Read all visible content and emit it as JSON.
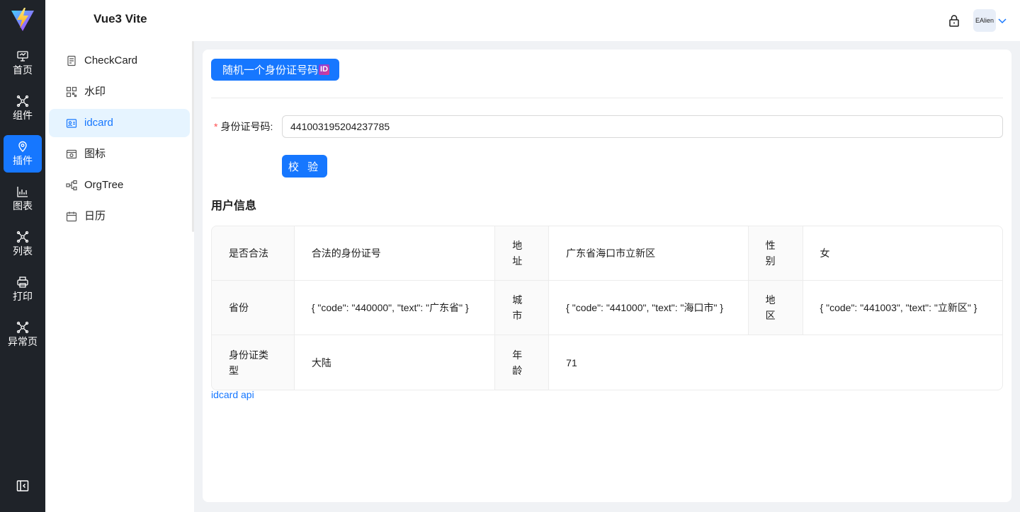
{
  "header": {
    "title": "Vue3 Vite",
    "user": "EAlien"
  },
  "nav": {
    "items": [
      {
        "label": "首页",
        "icon": "dashboard-icon",
        "active": false
      },
      {
        "label": "组件",
        "icon": "components-icon",
        "active": false
      },
      {
        "label": "插件",
        "icon": "plugin-icon",
        "active": true
      },
      {
        "label": "图表",
        "icon": "chart-icon",
        "active": false
      },
      {
        "label": "列表",
        "icon": "list-icon",
        "active": false
      },
      {
        "label": "打印",
        "icon": "printer-icon",
        "active": false
      },
      {
        "label": "异常页",
        "icon": "exception-icon",
        "active": false
      }
    ]
  },
  "submenu": {
    "items": [
      {
        "label": "CheckCard",
        "icon": "checkcard-icon",
        "active": false
      },
      {
        "label": "水印",
        "icon": "watermark-icon",
        "active": false
      },
      {
        "label": "idcard",
        "icon": "idcard-icon",
        "active": true
      },
      {
        "label": "图标",
        "icon": "icons-icon",
        "active": false
      },
      {
        "label": "OrgTree",
        "icon": "orgtree-icon",
        "active": false
      },
      {
        "label": "日历",
        "icon": "calendar-icon",
        "active": false
      }
    ]
  },
  "main": {
    "random_button": "随机一个身份证号码",
    "random_badge": "ID",
    "form": {
      "label": "身份证号码:",
      "value": "441003195204237785"
    },
    "verify_button": "校 验",
    "section_title": "用户信息",
    "table": {
      "rows": [
        [
          {
            "k": "是否合法",
            "v": "合法的身份证号"
          },
          {
            "k": "地址",
            "v": "广东省海口市立新区"
          },
          {
            "k": "性别",
            "v": "女"
          }
        ],
        [
          {
            "k": "省份",
            "v": "{ \"code\": \"440000\", \"text\": \"广东省\" }"
          },
          {
            "k": "城市",
            "v": "{ \"code\": \"441000\", \"text\": \"海口市\" }"
          },
          {
            "k": "地区",
            "v": "{ \"code\": \"441003\", \"text\": \"立新区\" }"
          }
        ],
        [
          {
            "k": "身份证类型",
            "v": "大陆"
          },
          {
            "k": "年龄",
            "v": "71"
          }
        ]
      ]
    },
    "api_link": "idcard api"
  },
  "colors": {
    "primary": "#1677ff",
    "rail": "#1f2329",
    "active_bg": "#e6f4ff"
  }
}
